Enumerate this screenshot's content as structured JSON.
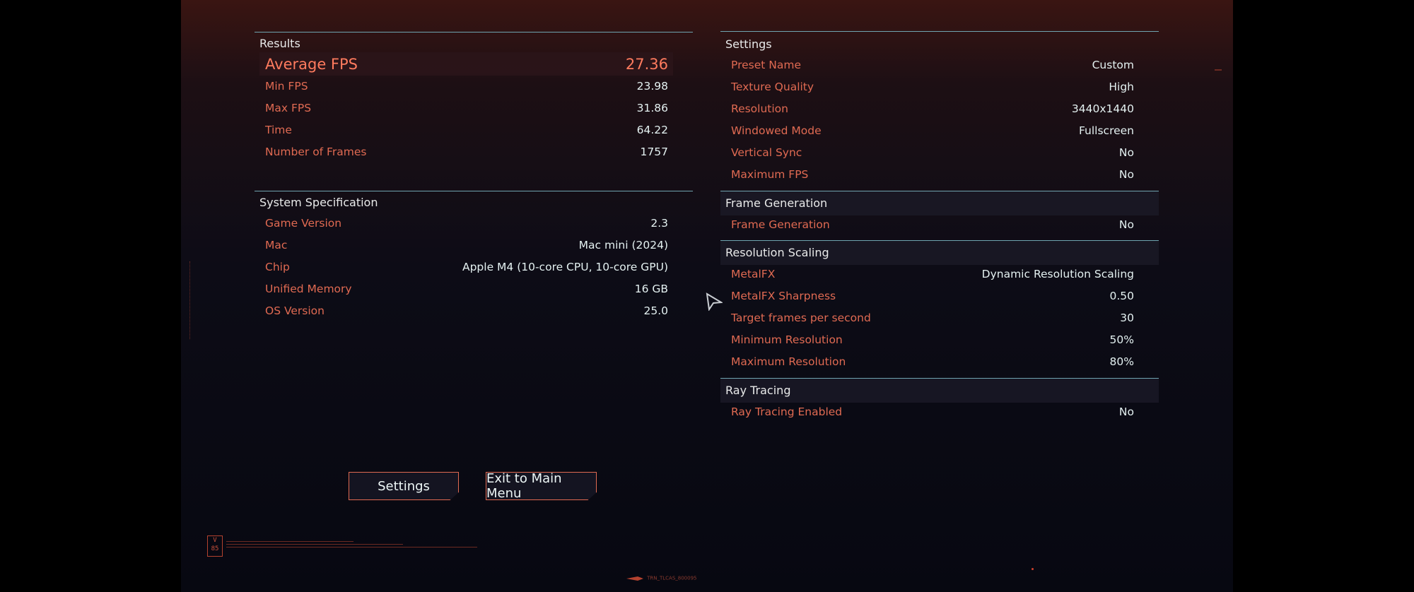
{
  "results": {
    "title": "Results",
    "average_fps": {
      "label": "Average FPS",
      "value": "27.36"
    },
    "rows": [
      {
        "label": "Min FPS",
        "value": "23.98"
      },
      {
        "label": "Max FPS",
        "value": "31.86"
      },
      {
        "label": "Time",
        "value": "64.22"
      },
      {
        "label": "Number of Frames",
        "value": "1757"
      }
    ]
  },
  "system": {
    "title": "System Specification",
    "rows": [
      {
        "label": "Game Version",
        "value": "2.3"
      },
      {
        "label": "Mac",
        "value": "Mac mini (2024)"
      },
      {
        "label": "Chip",
        "value": "Apple M4 (10-core CPU, 10-core GPU)"
      },
      {
        "label": "Unified Memory",
        "value": "16 GB"
      },
      {
        "label": "OS Version",
        "value": "25.0"
      }
    ]
  },
  "settings": {
    "title": "Settings",
    "rows": [
      {
        "label": "Preset Name",
        "value": "Custom"
      },
      {
        "label": "Texture Quality",
        "value": "High"
      },
      {
        "label": "Resolution",
        "value": "3440x1440"
      },
      {
        "label": "Windowed Mode",
        "value": "Fullscreen"
      },
      {
        "label": "Vertical Sync",
        "value": "No"
      },
      {
        "label": "Maximum FPS",
        "value": "No"
      }
    ]
  },
  "frame_generation": {
    "title": "Frame Generation",
    "rows": [
      {
        "label": "Frame Generation",
        "value": "No"
      }
    ]
  },
  "resolution_scaling": {
    "title": "Resolution Scaling",
    "rows": [
      {
        "label": "MetalFX",
        "value": "Dynamic Resolution Scaling"
      },
      {
        "label": "MetalFX Sharpness",
        "value": "0.50"
      },
      {
        "label": "Target frames per second",
        "value": "30"
      },
      {
        "label": "Minimum Resolution",
        "value": "50%"
      },
      {
        "label": "Maximum Resolution",
        "value": "80%"
      }
    ]
  },
  "ray_tracing": {
    "title": "Ray Tracing",
    "rows": [
      {
        "label": "Ray Tracing Enabled",
        "value": "No"
      }
    ]
  },
  "buttons": {
    "settings": "Settings",
    "exit": "Exit to Main Menu"
  },
  "footer": {
    "badge_top": "V",
    "badge_bottom": "85",
    "build_code": "TRN_TLCAS_800095"
  },
  "colors": {
    "accent": "#e06a52",
    "value_text": "#e4f1f1",
    "divider": "#6fa4b0",
    "highlight": "#ff7b5e"
  },
  "icons": [
    "pointer-cursor-icon",
    "arrow-marker-icon"
  ]
}
